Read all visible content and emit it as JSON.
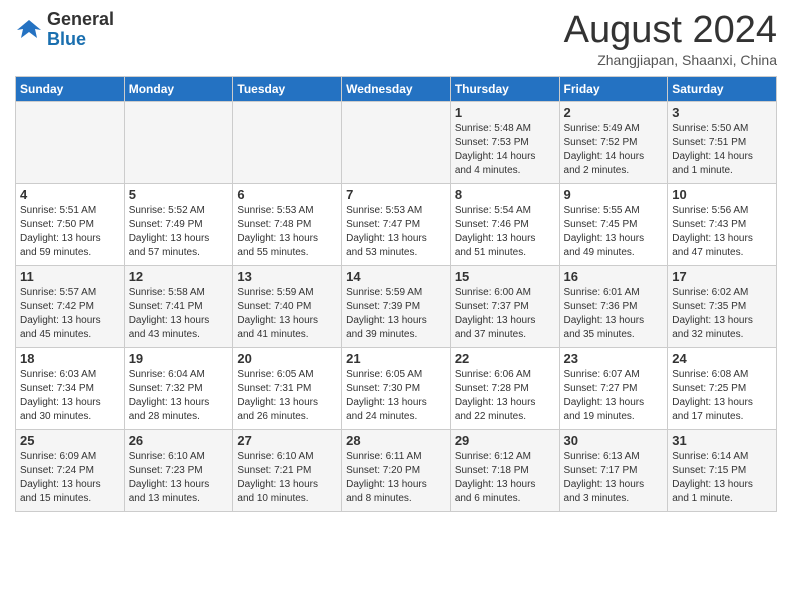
{
  "logo": {
    "general": "General",
    "blue": "Blue"
  },
  "header": {
    "month": "August 2024",
    "location": "Zhangjiapan, Shaanxi, China"
  },
  "weekdays": [
    "Sunday",
    "Monday",
    "Tuesday",
    "Wednesday",
    "Thursday",
    "Friday",
    "Saturday"
  ],
  "weeks": [
    [
      {
        "day": "",
        "info": ""
      },
      {
        "day": "",
        "info": ""
      },
      {
        "day": "",
        "info": ""
      },
      {
        "day": "",
        "info": ""
      },
      {
        "day": "1",
        "info": "Sunrise: 5:48 AM\nSunset: 7:53 PM\nDaylight: 14 hours\nand 4 minutes."
      },
      {
        "day": "2",
        "info": "Sunrise: 5:49 AM\nSunset: 7:52 PM\nDaylight: 14 hours\nand 2 minutes."
      },
      {
        "day": "3",
        "info": "Sunrise: 5:50 AM\nSunset: 7:51 PM\nDaylight: 14 hours\nand 1 minute."
      }
    ],
    [
      {
        "day": "4",
        "info": "Sunrise: 5:51 AM\nSunset: 7:50 PM\nDaylight: 13 hours\nand 59 minutes."
      },
      {
        "day": "5",
        "info": "Sunrise: 5:52 AM\nSunset: 7:49 PM\nDaylight: 13 hours\nand 57 minutes."
      },
      {
        "day": "6",
        "info": "Sunrise: 5:53 AM\nSunset: 7:48 PM\nDaylight: 13 hours\nand 55 minutes."
      },
      {
        "day": "7",
        "info": "Sunrise: 5:53 AM\nSunset: 7:47 PM\nDaylight: 13 hours\nand 53 minutes."
      },
      {
        "day": "8",
        "info": "Sunrise: 5:54 AM\nSunset: 7:46 PM\nDaylight: 13 hours\nand 51 minutes."
      },
      {
        "day": "9",
        "info": "Sunrise: 5:55 AM\nSunset: 7:45 PM\nDaylight: 13 hours\nand 49 minutes."
      },
      {
        "day": "10",
        "info": "Sunrise: 5:56 AM\nSunset: 7:43 PM\nDaylight: 13 hours\nand 47 minutes."
      }
    ],
    [
      {
        "day": "11",
        "info": "Sunrise: 5:57 AM\nSunset: 7:42 PM\nDaylight: 13 hours\nand 45 minutes."
      },
      {
        "day": "12",
        "info": "Sunrise: 5:58 AM\nSunset: 7:41 PM\nDaylight: 13 hours\nand 43 minutes."
      },
      {
        "day": "13",
        "info": "Sunrise: 5:59 AM\nSunset: 7:40 PM\nDaylight: 13 hours\nand 41 minutes."
      },
      {
        "day": "14",
        "info": "Sunrise: 5:59 AM\nSunset: 7:39 PM\nDaylight: 13 hours\nand 39 minutes."
      },
      {
        "day": "15",
        "info": "Sunrise: 6:00 AM\nSunset: 7:37 PM\nDaylight: 13 hours\nand 37 minutes."
      },
      {
        "day": "16",
        "info": "Sunrise: 6:01 AM\nSunset: 7:36 PM\nDaylight: 13 hours\nand 35 minutes."
      },
      {
        "day": "17",
        "info": "Sunrise: 6:02 AM\nSunset: 7:35 PM\nDaylight: 13 hours\nand 32 minutes."
      }
    ],
    [
      {
        "day": "18",
        "info": "Sunrise: 6:03 AM\nSunset: 7:34 PM\nDaylight: 13 hours\nand 30 minutes."
      },
      {
        "day": "19",
        "info": "Sunrise: 6:04 AM\nSunset: 7:32 PM\nDaylight: 13 hours\nand 28 minutes."
      },
      {
        "day": "20",
        "info": "Sunrise: 6:05 AM\nSunset: 7:31 PM\nDaylight: 13 hours\nand 26 minutes."
      },
      {
        "day": "21",
        "info": "Sunrise: 6:05 AM\nSunset: 7:30 PM\nDaylight: 13 hours\nand 24 minutes."
      },
      {
        "day": "22",
        "info": "Sunrise: 6:06 AM\nSunset: 7:28 PM\nDaylight: 13 hours\nand 22 minutes."
      },
      {
        "day": "23",
        "info": "Sunrise: 6:07 AM\nSunset: 7:27 PM\nDaylight: 13 hours\nand 19 minutes."
      },
      {
        "day": "24",
        "info": "Sunrise: 6:08 AM\nSunset: 7:25 PM\nDaylight: 13 hours\nand 17 minutes."
      }
    ],
    [
      {
        "day": "25",
        "info": "Sunrise: 6:09 AM\nSunset: 7:24 PM\nDaylight: 13 hours\nand 15 minutes."
      },
      {
        "day": "26",
        "info": "Sunrise: 6:10 AM\nSunset: 7:23 PM\nDaylight: 13 hours\nand 13 minutes."
      },
      {
        "day": "27",
        "info": "Sunrise: 6:10 AM\nSunset: 7:21 PM\nDaylight: 13 hours\nand 10 minutes."
      },
      {
        "day": "28",
        "info": "Sunrise: 6:11 AM\nSunset: 7:20 PM\nDaylight: 13 hours\nand 8 minutes."
      },
      {
        "day": "29",
        "info": "Sunrise: 6:12 AM\nSunset: 7:18 PM\nDaylight: 13 hours\nand 6 minutes."
      },
      {
        "day": "30",
        "info": "Sunrise: 6:13 AM\nSunset: 7:17 PM\nDaylight: 13 hours\nand 3 minutes."
      },
      {
        "day": "31",
        "info": "Sunrise: 6:14 AM\nSunset: 7:15 PM\nDaylight: 13 hours\nand 1 minute."
      }
    ]
  ]
}
